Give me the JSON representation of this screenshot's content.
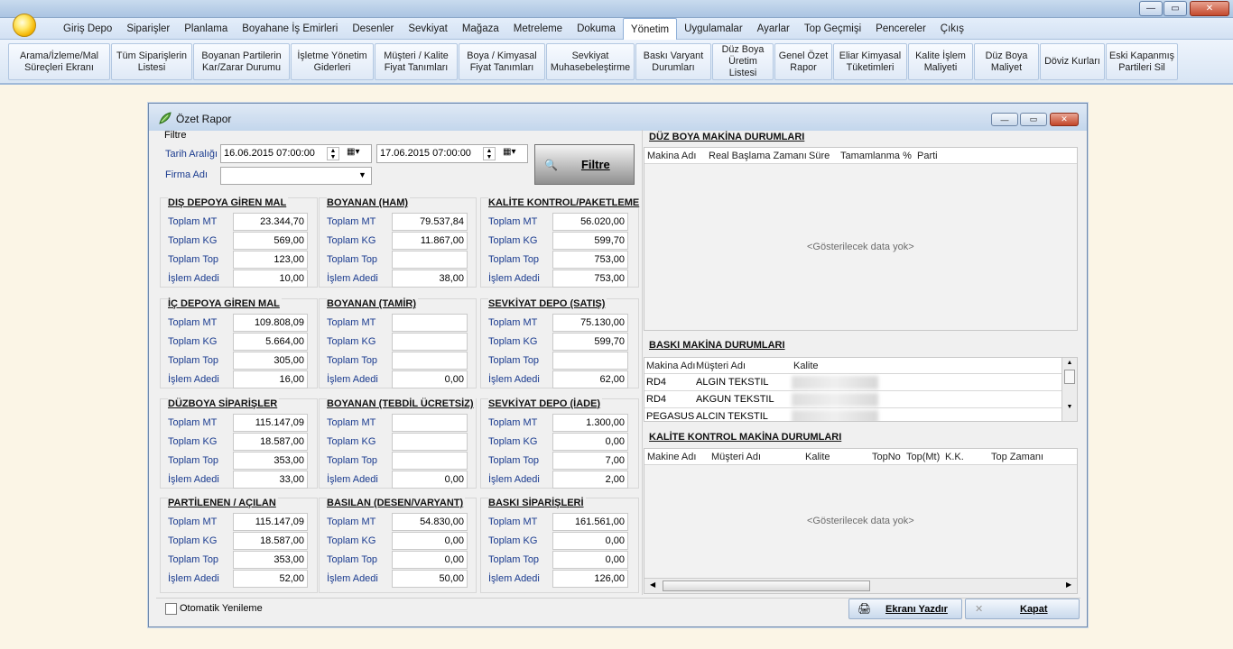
{
  "window": {
    "minimize": "—",
    "maximize": "▭",
    "close": "✕"
  },
  "menu": [
    "Giriş Depo",
    "Siparişler",
    "Planlama",
    "Boyahane İş Emirleri",
    "Desenler",
    "Sevkiyat",
    "Mağaza",
    "Metreleme",
    "Dokuma",
    "Yönetim",
    "Uygulamalar",
    "Ayarlar",
    "Top Geçmişi",
    "Pencereler",
    "Çıkış"
  ],
  "menu_active": "Yönetim",
  "ribbon": [
    "Arama/İzleme/Mal\nSüreçleri Ekranı",
    "Tüm Siparişlerin\nListesi",
    "Boyanan Partilerin\nKar/Zarar Durumu",
    "İşletme Yönetim\nGiderleri",
    "Müşteri / Kalite\nFiyat Tanımları",
    "Boya / Kimyasal\nFiyat Tanımları",
    "Sevkiyat\nMuhasebeleştirme",
    "Baskı Varyant\nDurumları",
    "Düz Boya\nÜretim Listesi",
    "Genel Özet\nRapor",
    "Eliar Kimyasal\nTüketimleri",
    "Kalite İşlem\nMaliyeti",
    "Düz Boya\nMaliyet",
    "Döviz Kurları",
    "Eski Kapanmış\nPartileri Sil"
  ],
  "report": {
    "title": "Özet Rapor",
    "filter_label": "Filtre",
    "date_label": "Tarih Aralığı",
    "date_from": "16.06.2015 07:00:00",
    "date_to": "17.06.2015 07:00:00",
    "firm_label": "Firma Adı",
    "firm_value": "",
    "filter_button": "Filtre",
    "auto_refresh": "Otomatik Yenileme",
    "print_button": "Ekranı Yazdır",
    "close_button": "Kapat",
    "row_labels": [
      "Toplam MT",
      "Toplam KG",
      "Toplam Top",
      "İşlem Adedi"
    ],
    "sections": [
      {
        "title": "DIŞ DEPOYA GİREN MAL",
        "values": [
          "23.344,70",
          "569,00",
          "123,00",
          "10,00"
        ]
      },
      {
        "title": "BOYANAN (HAM)",
        "values": [
          "79.537,84",
          "11.867,00",
          "",
          "38,00"
        ]
      },
      {
        "title": "KALİTE KONTROL/PAKETLEME",
        "values": [
          "56.020,00",
          "599,70",
          "753,00",
          "753,00"
        ]
      },
      {
        "title": "İÇ DEPOYA GİREN MAL",
        "values": [
          "109.808,09",
          "5.664,00",
          "305,00",
          "16,00"
        ]
      },
      {
        "title": "BOYANAN (TAMİR)",
        "values": [
          "",
          "",
          "",
          "0,00"
        ]
      },
      {
        "title": "SEVKİYAT DEPO (SATIŞ)",
        "values": [
          "75.130,00",
          "599,70",
          "",
          "62,00"
        ]
      },
      {
        "title": "DÜZBOYA SİPARİŞLER",
        "values": [
          "115.147,09",
          "18.587,00",
          "353,00",
          "33,00"
        ]
      },
      {
        "title": "BOYANAN (TEBDİL ÜCRETSİZ)",
        "values": [
          "",
          "",
          "",
          "0,00"
        ]
      },
      {
        "title": "SEVKİYAT DEPO (İADE)",
        "values": [
          "1.300,00",
          "0,00",
          "7,00",
          "2,00"
        ]
      },
      {
        "title": "PARTİLENEN / AÇILAN",
        "values": [
          "115.147,09",
          "18.587,00",
          "353,00",
          "52,00"
        ]
      },
      {
        "title": "BASILAN (DESEN/VARYANT)",
        "values": [
          "54.830,00",
          "0,00",
          "0,00",
          "50,00"
        ]
      },
      {
        "title": "BASKI SİPARİŞLERİ",
        "values": [
          "161.561,00",
          "0,00",
          "0,00",
          "126,00"
        ]
      }
    ],
    "duz_boya": {
      "title": "DÜZ BOYA MAKİNA DURUMLARI",
      "columns": [
        "Makina Adı",
        "Real Başlama Zamanı",
        "Süre",
        "Tamamlanma %",
        "Parti"
      ],
      "empty": "<Gösterilecek data yok>"
    },
    "baski": {
      "title": "BASKI MAKİNA DURUMLARI",
      "columns": [
        "Makina Adı",
        "Müşteri Adı",
        "Kalite"
      ],
      "rows": [
        [
          "RD4",
          "ALGIN TEKSTIL"
        ],
        [
          "RD4",
          "AKGUN TEKSTIL"
        ],
        [
          "PEGASUS",
          "ALCIN TEKSTIL"
        ]
      ]
    },
    "kalite": {
      "title": "KALİTE KONTROL MAKİNA DURUMLARI",
      "columns": [
        "Makine Adı",
        "Müşteri Adı",
        "Kalite",
        "TopNo",
        "Top(Mt)",
        "K.K.",
        "Top Zamanı"
      ],
      "empty": "<Gösterilecek data yok>"
    }
  }
}
